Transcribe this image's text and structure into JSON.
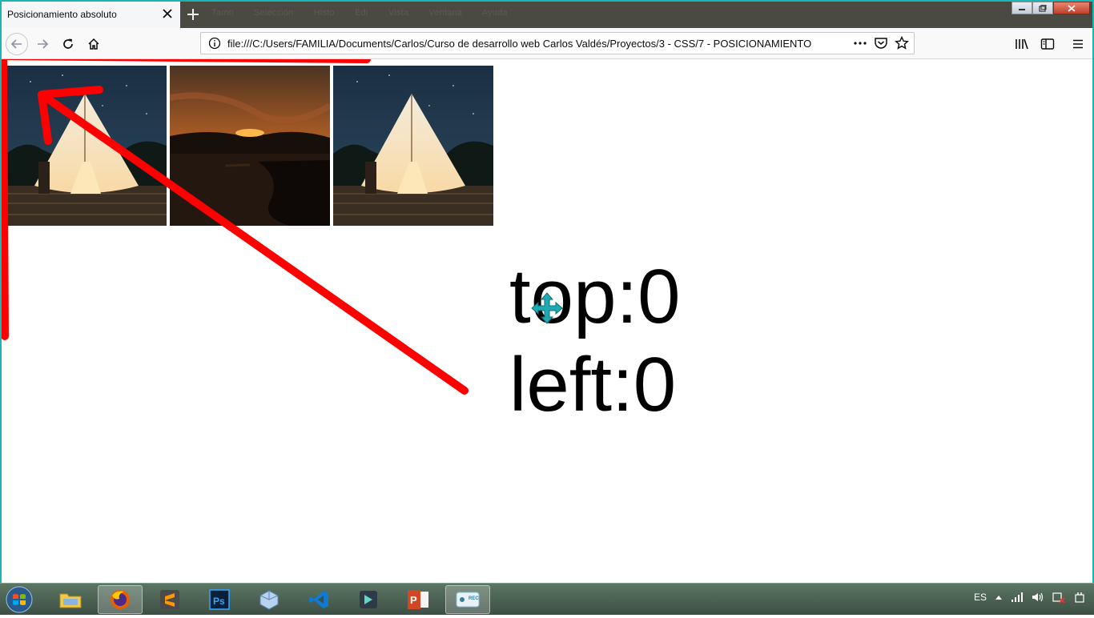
{
  "browser": {
    "tab_title": "Posicionamiento absoluto",
    "url": "file:///C:/Users/FAMILIA/Documents/Carlos/Curso de desarrollo web Carlos Valdés/Proyectos/3 - CSS/7 - POSICIONAMIENTO",
    "menu_hints": [
      "Tamo",
      "Selección",
      "Histo",
      "Edi",
      "Vista",
      "Ventana",
      "Ayuda"
    ]
  },
  "page": {
    "caption_line1": "top:0",
    "caption_line2": "left:0",
    "photos": [
      {
        "name": "tent-night-photo"
      },
      {
        "name": "sunset-lake-photo"
      },
      {
        "name": "tent-night-photo"
      }
    ]
  },
  "taskbar": {
    "language": "ES",
    "apps": [
      "file-explorer",
      "firefox",
      "sublime-text",
      "photoshop",
      "virtualbox",
      "vscode",
      "filmora",
      "powerpoint",
      "screen-recorder"
    ],
    "recorder_label": "REC"
  },
  "colors": {
    "annotation_red": "#ff0000",
    "frame_teal": "#1cb5b5",
    "taskbar": "#4a6354"
  }
}
